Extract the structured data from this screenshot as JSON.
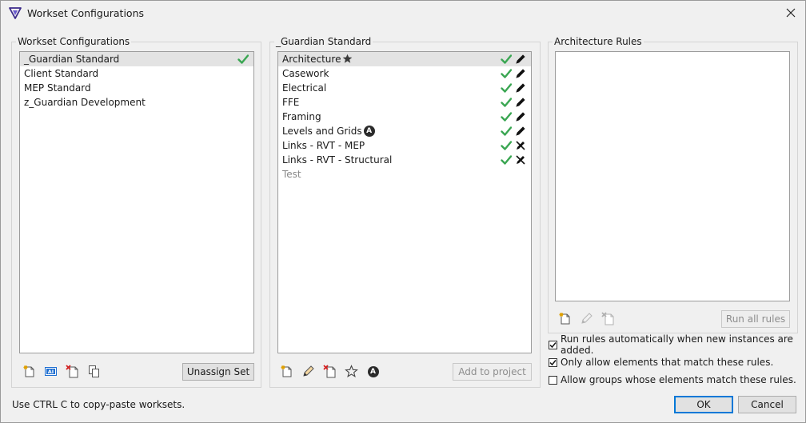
{
  "window": {
    "title": "Workset Configurations"
  },
  "left_panel": {
    "title": "Workset Configurations",
    "items": [
      {
        "label": "_Guardian Standard",
        "selected": true,
        "active": true
      },
      {
        "label": "Client Standard",
        "selected": false,
        "active": false
      },
      {
        "label": "MEP Standard",
        "selected": false,
        "active": false
      },
      {
        "label": "z_Guardian Development",
        "selected": false,
        "active": false
      }
    ],
    "toolbar": [
      "new-icon",
      "rename-icon",
      "delete-icon",
      "copy-icon"
    ],
    "unassign_label": "Unassign Set"
  },
  "middle_panel": {
    "title": "_Guardian Standard",
    "items": [
      {
        "label": "Architecture",
        "badge": "star",
        "checked": true,
        "tool": "edit",
        "selected": true,
        "disabled": false
      },
      {
        "label": "Casework",
        "badge": "",
        "checked": true,
        "tool": "edit",
        "selected": false,
        "disabled": false
      },
      {
        "label": "Electrical",
        "badge": "",
        "checked": true,
        "tool": "edit",
        "selected": false,
        "disabled": false
      },
      {
        "label": "FFE",
        "badge": "",
        "checked": true,
        "tool": "edit",
        "selected": false,
        "disabled": false
      },
      {
        "label": "Framing",
        "badge": "",
        "checked": true,
        "tool": "edit",
        "selected": false,
        "disabled": false
      },
      {
        "label": "Levels and Grids",
        "badge": "A",
        "checked": true,
        "tool": "edit",
        "selected": false,
        "disabled": false
      },
      {
        "label": "Links - RVT - MEP",
        "badge": "",
        "checked": true,
        "tool": "no-edit",
        "selected": false,
        "disabled": false
      },
      {
        "label": "Links - RVT - Structural",
        "badge": "",
        "checked": true,
        "tool": "no-edit",
        "selected": false,
        "disabled": false
      },
      {
        "label": "Test",
        "badge": "",
        "checked": false,
        "tool": "",
        "selected": false,
        "disabled": true
      }
    ],
    "add_to_project_label": "Add to project",
    "a_badge_text": "A"
  },
  "right_panel": {
    "title": "Architecture Rules",
    "run_all_label": "Run all rules"
  },
  "options": [
    {
      "label": "Run rules automatically when new instances are added.",
      "checked": true
    },
    {
      "label": "Only allow elements that match these rules.",
      "checked": true
    },
    {
      "label": "Allow groups whose elements match these rules.",
      "checked": false
    }
  ],
  "footer": {
    "hint": "Use CTRL C to copy-paste worksets.",
    "ok_label": "OK",
    "cancel_label": "Cancel"
  },
  "colors": {
    "check_green": "#3aa652",
    "accent_blue": "#0078d7",
    "selection_gray": "#e3e3e3"
  }
}
